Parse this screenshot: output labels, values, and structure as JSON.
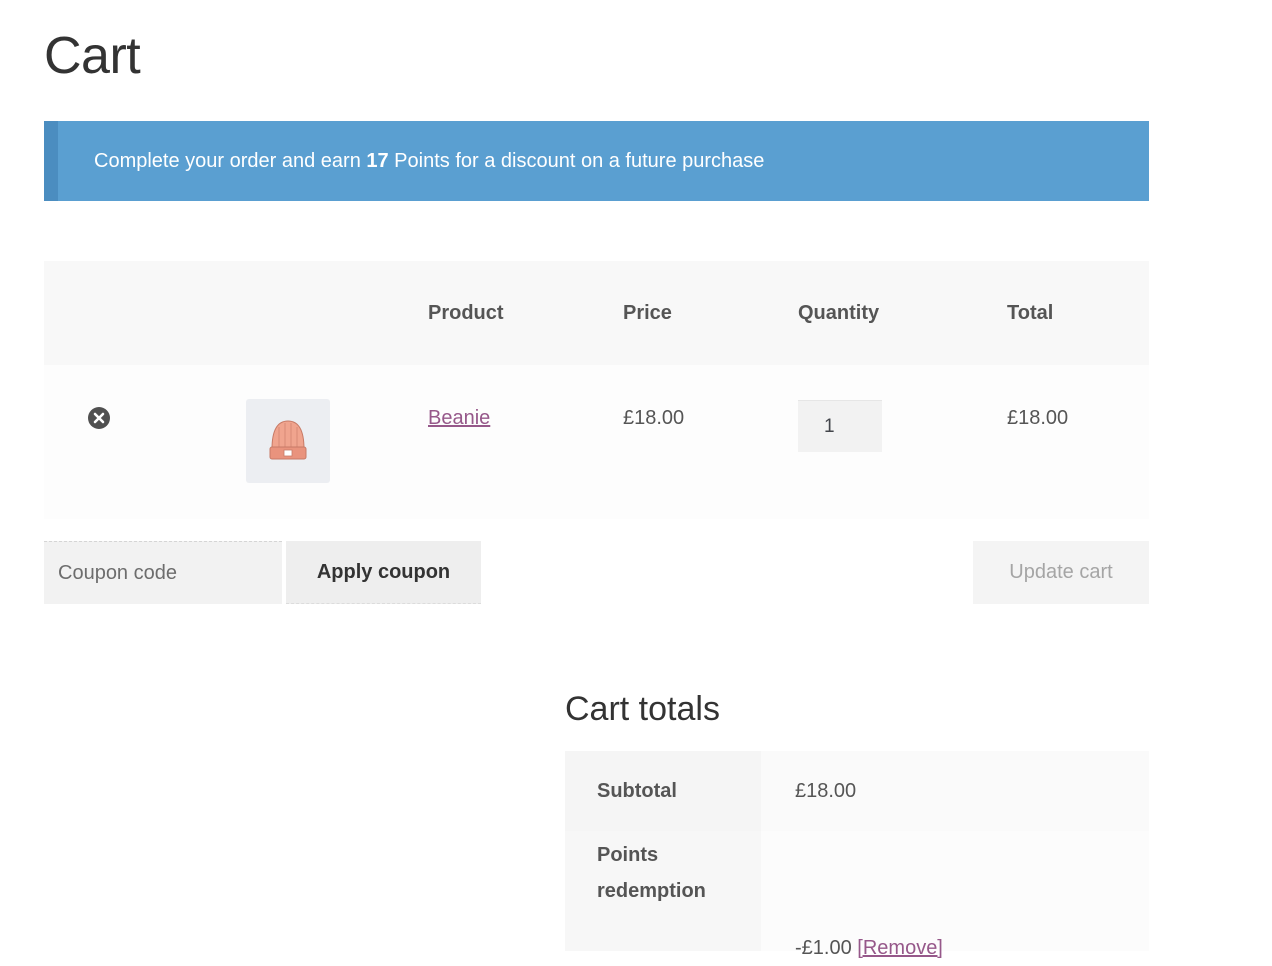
{
  "page": {
    "title": "Cart"
  },
  "notice": {
    "text_before": "Complete your order and earn ",
    "points": "17",
    "text_after": " Points for a discount on a future purchase",
    "color": "#5a9fd1"
  },
  "cart_table": {
    "headers": {
      "product": "Product",
      "price": "Price",
      "quantity": "Quantity",
      "total": "Total"
    },
    "items": [
      {
        "name": "Beanie",
        "price": "£18.00",
        "quantity": "1",
        "total": "£18.00",
        "remove_icon": "remove-circle-icon",
        "thumbnail_icon": "beanie-hat-icon"
      }
    ]
  },
  "actions": {
    "coupon_placeholder": "Coupon code",
    "apply_coupon_label": "Apply coupon",
    "update_cart_label": "Update cart"
  },
  "totals": {
    "title": "Cart totals",
    "subtotal_label": "Subtotal",
    "subtotal_value": "£18.00",
    "points_label_line1": "Points",
    "points_label_line2": "redemption",
    "points_value": "-£1.00",
    "points_remove_label": "[Remove]"
  },
  "colors": {
    "link": "#96588a",
    "notice_bg": "#5a9fd1"
  }
}
